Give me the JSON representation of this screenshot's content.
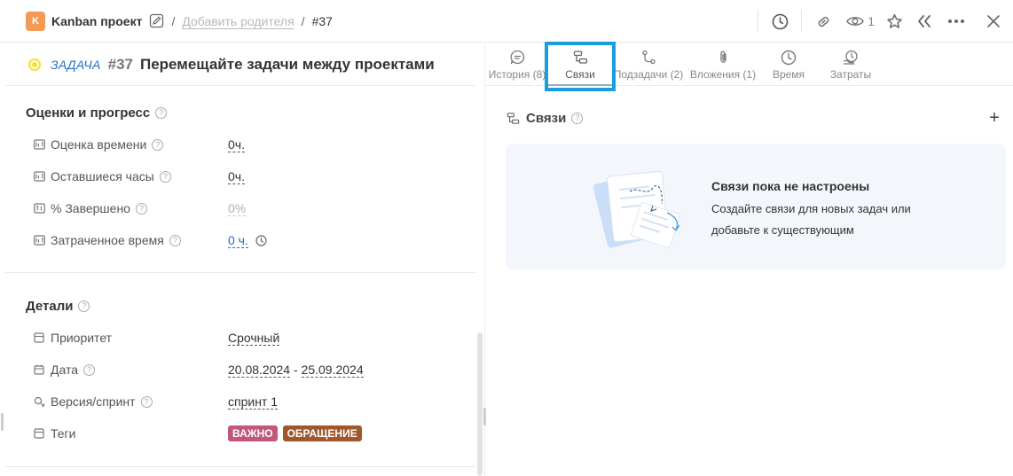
{
  "header": {
    "project_badge": "K",
    "project_name": "Kanban проект",
    "separator": "/",
    "add_parent": "Добавить родителя",
    "task_ref": "#37",
    "watchers_count": "1"
  },
  "task": {
    "type": "ЗАДАЧА",
    "number": "#37",
    "title": "Перемещайте задачи между проектами",
    "status_color": "#f6df2c"
  },
  "estimates": {
    "title": "Оценки и прогресс",
    "rows": [
      {
        "label": "Оценка времени",
        "value": "0ч."
      },
      {
        "label": "Оставшиеся часы",
        "value": "0ч."
      },
      {
        "label": "% Завершено",
        "value": "0%"
      },
      {
        "label": "Затраченное время",
        "value": "0 ч."
      }
    ]
  },
  "details": {
    "title": "Детали",
    "priority": {
      "label": "Приоритет",
      "value": "Срочный"
    },
    "date": {
      "label": "Дата",
      "start": "20.08.2024",
      "dash": " - ",
      "end": "25.09.2024"
    },
    "version": {
      "label": "Версия/спринт",
      "value": "спринт 1"
    },
    "tags": {
      "label": "Теги",
      "items": [
        {
          "text": "ВАЖНО",
          "color": "#c2577a"
        },
        {
          "text": "ОБРАЩЕНИЕ",
          "color": "#a0572e"
        }
      ]
    }
  },
  "tabs": [
    {
      "label": "История (8)",
      "icon": "history-bubble-icon"
    },
    {
      "label": "Связи",
      "icon": "links-icon"
    },
    {
      "label": "Подзадачи (2)",
      "icon": "subtasks-icon"
    },
    {
      "label": "Вложения (1)",
      "icon": "paperclip-icon"
    },
    {
      "label": "Время",
      "icon": "clock-icon"
    },
    {
      "label": "Затраты",
      "icon": "costs-icon"
    }
  ],
  "links_panel": {
    "title": "Связи",
    "add_symbol": "+",
    "empty_title": "Связи пока не настроены",
    "empty_text_1": "Создайте связи для новых задач или",
    "empty_text_2": "добавьте к существующим"
  },
  "colors": {
    "accent_blue": "#1d6fc4",
    "highlight": "#1a9ee0",
    "project_badge": "#f39b56"
  }
}
